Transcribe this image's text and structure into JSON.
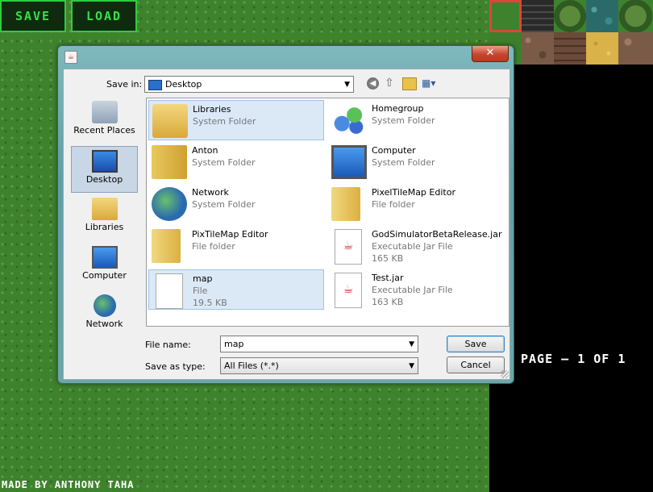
{
  "game": {
    "save_label": "SAVE",
    "load_label": "LOAD",
    "page_text": "PAGE — 1 OF 1",
    "credit": "MADE BY ANTHONY TAHA",
    "palette_tiles": [
      "grass-tile",
      "stone-brick-tile",
      "tree-tile",
      "water-tile",
      "tree-tile",
      "dirt-tile",
      "wood-plank-tile",
      "sand-tile",
      "dirt-tile"
    ]
  },
  "dialog": {
    "save_in_label": "Save in:",
    "save_in_value": "Desktop",
    "close_glyph": "✕",
    "sidebar": [
      {
        "label": "Recent Places",
        "icon": "recent-places-icon",
        "selected": false
      },
      {
        "label": "Desktop",
        "icon": "desktop-icon",
        "selected": true
      },
      {
        "label": "Libraries",
        "icon": "libraries-icon",
        "selected": false
      },
      {
        "label": "Computer",
        "icon": "computer-icon",
        "selected": false
      },
      {
        "label": "Network",
        "icon": "network-icon",
        "selected": false
      }
    ],
    "files": [
      {
        "name": "Libraries",
        "l1": "System Folder",
        "l2": "",
        "icon": "libraries-icon"
      },
      {
        "name": "Homegroup",
        "l1": "System Folder",
        "l2": "",
        "icon": "homegroup-icon"
      },
      {
        "name": "Anton",
        "l1": "System Folder",
        "l2": "",
        "icon": "user-folder-icon"
      },
      {
        "name": "Computer",
        "l1": "System Folder",
        "l2": "",
        "icon": "computer-icon"
      },
      {
        "name": "Network",
        "l1": "System Folder",
        "l2": "",
        "icon": "network-icon"
      },
      {
        "name": "PixelTileMap Editor",
        "l1": "File folder",
        "l2": "",
        "icon": "folder-icon"
      },
      {
        "name": "PixTileMap Editor",
        "l1": "File folder",
        "l2": "",
        "icon": "folder-icon"
      },
      {
        "name": "GodSimulatorBetaRelease.jar",
        "l1": "Executable Jar File",
        "l2": "165 KB",
        "icon": "jar-file-icon"
      },
      {
        "name": "map",
        "l1": "File",
        "l2": "19.5 KB",
        "icon": "file-icon"
      },
      {
        "name": "Test.jar",
        "l1": "Executable Jar File",
        "l2": "163 KB",
        "icon": "jar-file-icon"
      }
    ],
    "file_name_label": "File name:",
    "file_name_value": "map",
    "save_as_type_label": "Save as type:",
    "save_as_type_value": "All Files (*.*)",
    "save_button": "Save",
    "cancel_button": "Cancel"
  }
}
